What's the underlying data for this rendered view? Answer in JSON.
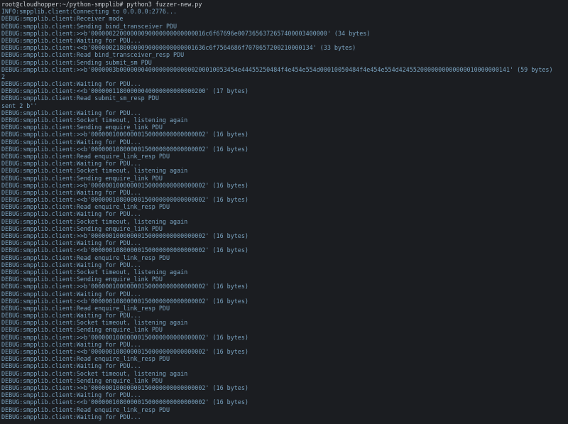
{
  "terminal": {
    "lines": [
      "root@cloudhopper:~/python-smpplib# python3 fuzzer-new.py",
      "INFO:smpplib.client:Connecting to 0.0.0.0:2776...",
      "DEBUG:smpplib.client:Receiver mode",
      "DEBUG:smpplib.client:Sending bind_transceiver PDU",
      "DEBUG:smpplib.client:>>b'00000022000000090000000000000016c6f67696e0073656372657400003400000' (34 bytes)",
      "DEBUG:smpplib.client:Waiting for PDU...",
      "DEBUG:smpplib.client:<<b'00000021800000090000000000001636c6f7564686f7070657200210000134' (33 bytes)",
      "DEBUG:smpplib.client:Read bind_transceiver_resp PDU",
      "DEBUG:smpplib.client:Sending submit_sm PDU",
      "DEBUG:smpplib.client:>>b'0000003b000000040000000000000200010053454e44455250484f4e454e554d00010050484f4e454e554d4245520000000000000010000000141' (59 bytes)",
      "2",
      "DEBUG:smpplib.client:Waiting for PDU...",
      "DEBUG:smpplib.client:<<b'00000011800000040000000000000200' (17 bytes)",
      "DEBUG:smpplib.client:Read submit_sm_resp PDU",
      "sent 2 b''",
      "DEBUG:smpplib.client:Waiting for PDU...",
      "DEBUG:smpplib.client:Socket timeout, listening again",
      "DEBUG:smpplib.client:Sending enquire_link PDU",
      "DEBUG:smpplib.client:>>b'00000010000000150000000000000002' (16 bytes)",
      "DEBUG:smpplib.client:Waiting for PDU...",
      "DEBUG:smpplib.client:<<b'00000010800000150000000000000002' (16 bytes)",
      "DEBUG:smpplib.client:Read enquire_link_resp PDU",
      "DEBUG:smpplib.client:Waiting for PDU...",
      "DEBUG:smpplib.client:Socket timeout, listening again",
      "DEBUG:smpplib.client:Sending enquire_link PDU",
      "DEBUG:smpplib.client:>>b'00000010000000150000000000000002' (16 bytes)",
      "DEBUG:smpplib.client:Waiting for PDU...",
      "DEBUG:smpplib.client:<<b'00000010800000150000000000000002' (16 bytes)",
      "DEBUG:smpplib.client:Read enquire_link_resp PDU",
      "DEBUG:smpplib.client:Waiting for PDU...",
      "DEBUG:smpplib.client:Socket timeout, listening again",
      "DEBUG:smpplib.client:Sending enquire_link PDU",
      "DEBUG:smpplib.client:>>b'00000010000000150000000000000002' (16 bytes)",
      "DEBUG:smpplib.client:Waiting for PDU...",
      "DEBUG:smpplib.client:<<b'00000010800000150000000000000002' (16 bytes)",
      "DEBUG:smpplib.client:Read enquire_link_resp PDU",
      "DEBUG:smpplib.client:Waiting for PDU...",
      "DEBUG:smpplib.client:Socket timeout, listening again",
      "DEBUG:smpplib.client:Sending enquire_link PDU",
      "DEBUG:smpplib.client:>>b'00000010000000150000000000000002' (16 bytes)",
      "DEBUG:smpplib.client:Waiting for PDU...",
      "DEBUG:smpplib.client:<<b'00000010800000150000000000000002' (16 bytes)",
      "DEBUG:smpplib.client:Read enquire_link_resp PDU",
      "DEBUG:smpplib.client:Waiting for PDU...",
      "DEBUG:smpplib.client:Socket timeout, listening again",
      "DEBUG:smpplib.client:Sending enquire_link PDU",
      "DEBUG:smpplib.client:>>b'00000010000000150000000000000002' (16 bytes)",
      "DEBUG:smpplib.client:Waiting for PDU...",
      "DEBUG:smpplib.client:<<b'00000010800000150000000000000002' (16 bytes)",
      "DEBUG:smpplib.client:Read enquire_link_resp PDU",
      "DEBUG:smpplib.client:Waiting for PDU...",
      "DEBUG:smpplib.client:Socket timeout, listening again",
      "DEBUG:smpplib.client:Sending enquire_link PDU",
      "DEBUG:smpplib.client:>>b'00000010000000150000000000000002' (16 bytes)",
      "DEBUG:smpplib.client:Waiting for PDU...",
      "DEBUG:smpplib.client:<<b'00000010800000150000000000000002' (16 bytes)",
      "DEBUG:smpplib.client:Read enquire_link_resp PDU",
      "DEBUG:smpplib.client:Waiting for PDU..."
    ]
  },
  "colors": {
    "background": "#1b1d21",
    "prompt_text": "#c8cdd2",
    "log_text": "#7aa3c0"
  }
}
